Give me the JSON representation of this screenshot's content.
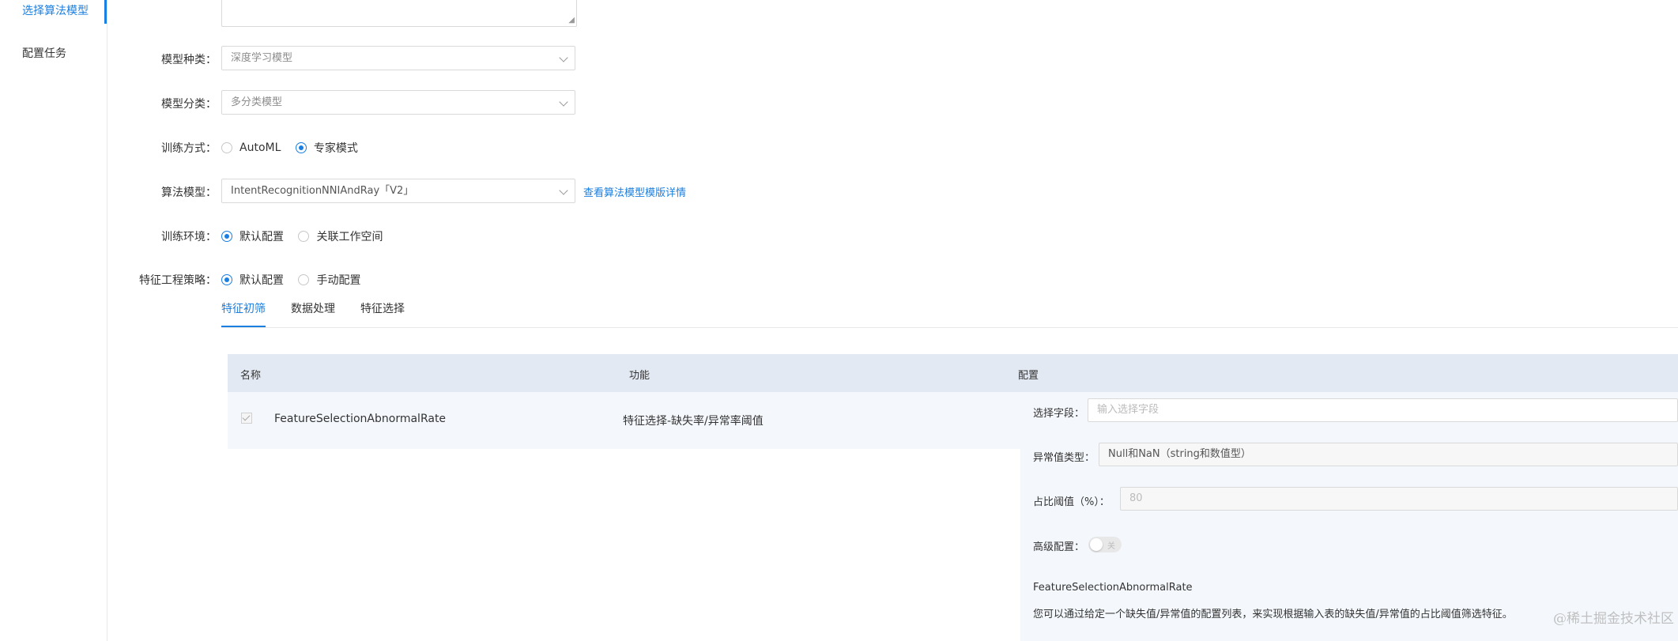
{
  "sidebar": {
    "items": [
      {
        "label": "选择算法模型",
        "active": true
      },
      {
        "label": "配置任务",
        "active": false
      }
    ]
  },
  "form": {
    "model_kind": {
      "label": "模型种类：",
      "value": "深度学习模型"
    },
    "model_class": {
      "label": "模型分类：",
      "value": "多分类模型"
    },
    "train_mode": {
      "label": "训练方式：",
      "options": [
        "AutoML",
        "专家模式"
      ],
      "selected": "专家模式"
    },
    "algorithm": {
      "label": "算法模型：",
      "value": "IntentRecognitionNNIAndRay「V2」",
      "link": "查看算法模型模版详情"
    },
    "train_env": {
      "label": "训练环境：",
      "options": [
        "默认配置",
        "关联工作空间"
      ],
      "selected": "默认配置"
    },
    "feature_strategy": {
      "label": "特征工程策略：",
      "options": [
        "默认配置",
        "手动配置"
      ],
      "selected": "默认配置"
    }
  },
  "tabs": [
    {
      "label": "特征初筛",
      "active": true
    },
    {
      "label": "数据处理",
      "active": false
    },
    {
      "label": "特征选择",
      "active": false
    }
  ],
  "table": {
    "headers": [
      "名称",
      "功能",
      "配置"
    ],
    "rows": [
      {
        "name": "FeatureSelectionAbnormalRate",
        "function": "特征选择-缺失率/异常率阈值",
        "checked": true
      }
    ]
  },
  "config": {
    "field": {
      "label": "选择字段：",
      "placeholder": "输入选择字段"
    },
    "abnormal_type": {
      "label": "异常值类型：",
      "value": "Null和NaN（string和数值型）"
    },
    "ratio": {
      "label": "占比阈值（%）：",
      "value": "80"
    },
    "advanced": {
      "label": "高级配置：",
      "toggle_text": "关",
      "on": false
    },
    "description_title": "FeatureSelectionAbnormalRate",
    "description": "您可以通过给定一个缺失值/异常值的配置列表，来实现根据输入表的缺失值/异常值的占比阈值筛选特征。"
  },
  "watermark": "@稀土掘金技术社区",
  "colors": {
    "accent": "#1a7fe0",
    "header_bg": "#e3e9f2",
    "row_bg": "#f4f8fc"
  }
}
